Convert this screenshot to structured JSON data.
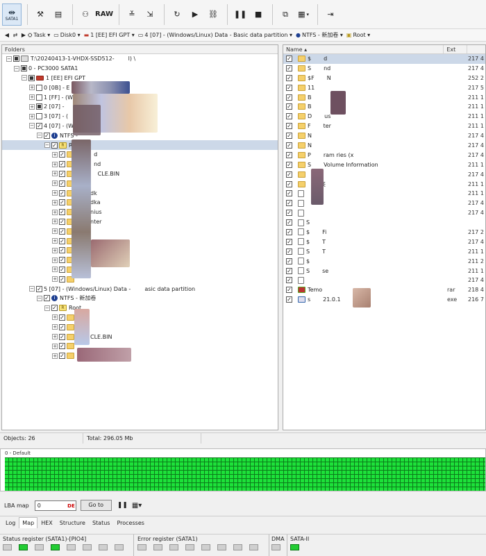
{
  "toolbar": {
    "sata_label": "SATA1",
    "raw_label": "RAW"
  },
  "address": {
    "task": "Task",
    "disk": "Disk0",
    "partition_gpt": "1 [EE] EFI GPT",
    "partition": "4 [07] - (Windows/Linux) Data - Basic data partition",
    "volume": "NTFS - 新加卷",
    "root": "Root"
  },
  "left_pane": {
    "header": "Folders",
    "tree": [
      {
        "label": "T:\\20240413-1-VHDX-SSD512-",
        "label2": "l) \\",
        "indent": 0,
        "exp": "-",
        "check": "part",
        "icon": "pc"
      },
      {
        "label": "0 - PC3000 SATA1",
        "indent": 1,
        "exp": "-",
        "check": "part",
        "icon": "none"
      },
      {
        "label": "1 [EE] EFI GPT",
        "indent": 2,
        "exp": "-",
        "check": "part",
        "icon": "disk"
      },
      {
        "label": "0 [0B] - E",
        "indent": 3,
        "exp": "+",
        "check": "off",
        "icon": "none"
      },
      {
        "label": "1 [FF] - (W",
        "indent": 3,
        "exp": "+",
        "check": "off",
        "icon": "none"
      },
      {
        "label": "2 [07] - ",
        "label2": "Basic data partition",
        "indent": 3,
        "exp": "+",
        "check": "part",
        "icon": "none"
      },
      {
        "label": "3 [07] - (",
        "indent": 3,
        "exp": "+",
        "check": "off",
        "icon": "none"
      },
      {
        "label": "4 [07] - (W",
        "label2": "n",
        "indent": 3,
        "exp": "-",
        "check": "on",
        "icon": "none"
      },
      {
        "label": "NTFS - ",
        "indent": 4,
        "exp": "-",
        "check": "on",
        "icon": "ntfs"
      },
      {
        "label": "R",
        "indent": 5,
        "exp": "-",
        "check": "on",
        "icon": "root",
        "selected": true
      },
      {
        "label": "S",
        "label2": "d",
        "indent": 6,
        "exp": "+",
        "check": "on",
        "icon": "folder"
      },
      {
        "label": "S",
        "label2": "nd",
        "indent": 6,
        "exp": "+",
        "check": "on",
        "icon": "folder"
      },
      {
        "label": "$R",
        "label2": "CLE.BIN",
        "indent": 6,
        "exp": "+",
        "check": "on",
        "icon": "folder"
      },
      {
        "label": "11",
        "indent": 6,
        "exp": "+",
        "check": "on",
        "icon": "folder"
      },
      {
        "label": "",
        "label2": "dk",
        "indent": 6,
        "exp": "+",
        "check": "on",
        "icon": "folder"
      },
      {
        "label": "",
        "label2": "dka",
        "indent": 6,
        "exp": "+",
        "check": "on",
        "icon": "folder"
      },
      {
        "label": "",
        "label2": "nius",
        "indent": 6,
        "exp": "+",
        "check": "on",
        "icon": "folder"
      },
      {
        "label": "",
        "label2": "nter",
        "indent": 6,
        "exp": "+",
        "check": "on",
        "icon": "folder"
      },
      {
        "label": "D",
        "indent": 6,
        "exp": "+",
        "check": "on",
        "icon": "folder"
      },
      {
        "label": "T",
        "indent": 6,
        "exp": "+",
        "check": "on",
        "icon": "folder"
      },
      {
        "label": "",
        "indent": 6,
        "exp": "+",
        "check": "on",
        "icon": "folder"
      },
      {
        "label": "",
        "indent": 6,
        "exp": "+",
        "check": "on",
        "icon": "folder"
      },
      {
        "label": "",
        "indent": 6,
        "exp": "+",
        "check": "on",
        "icon": "folder"
      },
      {
        "label": "",
        "indent": 6,
        "exp": "+",
        "check": "on",
        "icon": "folder"
      },
      {
        "label": "5 [07] - (Windows/Linux) Data - ",
        "label2": "asic data partition",
        "indent": 3,
        "exp": "-",
        "check": "on",
        "icon": "none"
      },
      {
        "label": "NTFS - 新加卷",
        "indent": 4,
        "exp": "-",
        "check": "on",
        "icon": "ntfs"
      },
      {
        "label": "Root",
        "indent": 5,
        "exp": "-",
        "check": "on",
        "icon": "root"
      },
      {
        "label": "",
        "indent": 6,
        "exp": "+",
        "check": "on",
        "icon": "folder"
      },
      {
        "label": "",
        "indent": 6,
        "exp": "+",
        "check": "on",
        "icon": "folder"
      },
      {
        "label": "",
        "label2": "CLE.BIN",
        "indent": 6,
        "exp": "+",
        "check": "on",
        "icon": "folder"
      },
      {
        "label": "",
        "indent": 6,
        "exp": "+",
        "check": "on",
        "icon": "folder"
      },
      {
        "label": "",
        "indent": 6,
        "exp": "+",
        "check": "on",
        "icon": "folder"
      }
    ]
  },
  "right_pane": {
    "col_name": "Name",
    "col_ext": "Ext",
    "files": [
      {
        "name": "$",
        "name2": "d",
        "ext": "",
        "size": "217 4",
        "icon": "folder",
        "selected": true
      },
      {
        "name": "S",
        "name2": "nd",
        "ext": "",
        "size": "217 4",
        "icon": "folder"
      },
      {
        "name": "$F",
        "name2": "N",
        "ext": "",
        "size": "252 2",
        "icon": "folder"
      },
      {
        "name": "11",
        "ext": "",
        "size": "217 5",
        "icon": "folder"
      },
      {
        "name": "B",
        "ext": "",
        "size": "211 1",
        "icon": "folder"
      },
      {
        "name": "B",
        "ext": "",
        "size": "211 1",
        "icon": "folder"
      },
      {
        "name": "D",
        "name2": "us",
        "ext": "",
        "size": "211 1",
        "icon": "folder"
      },
      {
        "name": "F",
        "name2": "ter",
        "ext": "",
        "size": "211 1",
        "icon": "folder"
      },
      {
        "name": "N",
        "ext": "",
        "size": "217 4",
        "icon": "folder"
      },
      {
        "name": "N",
        "ext": "",
        "size": "217 4",
        "icon": "folder"
      },
      {
        "name": "P",
        "name2": "ram ries (x",
        "ext": "",
        "size": "217 4",
        "icon": "folder"
      },
      {
        "name": "S",
        "name2": "Volume Information",
        "ext": "",
        "size": "211 1",
        "icon": "folder"
      },
      {
        "name": "",
        "ext": "",
        "size": "217 4",
        "icon": "folder"
      },
      {
        "name": "",
        "name2": "夹",
        "ext": "",
        "size": "211 1",
        "icon": "folder"
      },
      {
        "name": "",
        "ext": "",
        "size": "211 1",
        "icon": "file"
      },
      {
        "name": "",
        "ext": "",
        "size": "217 4",
        "icon": "file"
      },
      {
        "name": "",
        "ext": "",
        "size": "217 4",
        "icon": "file"
      },
      {
        "name": "S",
        "ext": "",
        "size": "",
        "icon": "file"
      },
      {
        "name": "$",
        "name2": "Fi",
        "ext": "",
        "size": "217 2",
        "icon": "file"
      },
      {
        "name": "$",
        "name2": "T",
        "ext": "",
        "size": "217 4",
        "icon": "file"
      },
      {
        "name": "S",
        "name2": "T",
        "ext": "",
        "size": "211 1",
        "icon": "file"
      },
      {
        "name": "$",
        "ext": "",
        "size": "211 2",
        "icon": "file"
      },
      {
        "name": "S",
        "name2": "se",
        "ext": "",
        "size": "211 1",
        "icon": "file"
      },
      {
        "name": "",
        "ext": "",
        "size": "217 4",
        "icon": "file"
      },
      {
        "name": "Temo",
        "ext": "rar",
        "size": "218 4",
        "icon": "rar"
      },
      {
        "name": "s",
        "name2": "21.0.1",
        "ext": "exe",
        "size": "216 7",
        "icon": "exe"
      }
    ]
  },
  "status": {
    "objects": "Objects: 26",
    "total": "Total: 296.05 Mb"
  },
  "map_panel": {
    "label": "0 - Default"
  },
  "lba": {
    "label": "LBA map",
    "value": "0",
    "goto": "Go to"
  },
  "tabs": [
    "Log",
    "Map",
    "HEX",
    "Structure",
    "Status",
    "Processes"
  ],
  "active_tab": "Map",
  "registers": {
    "status_title": "Status register (SATA1)-[PIO4]",
    "error_title": "Error register (SATA1)",
    "dma_title": "DMA",
    "sata_title": "SATA-II",
    "status_leds": [
      false,
      true,
      false,
      true,
      false,
      false,
      false,
      false
    ],
    "error_leds": [
      false,
      false,
      false,
      false,
      false,
      false,
      false,
      false
    ],
    "dma_leds": [
      false
    ],
    "sata_leds": [
      true
    ]
  },
  "colors": {
    "led_on": "#22cc33",
    "map_green": "#1de13a",
    "selection": "#ccd8e8"
  }
}
